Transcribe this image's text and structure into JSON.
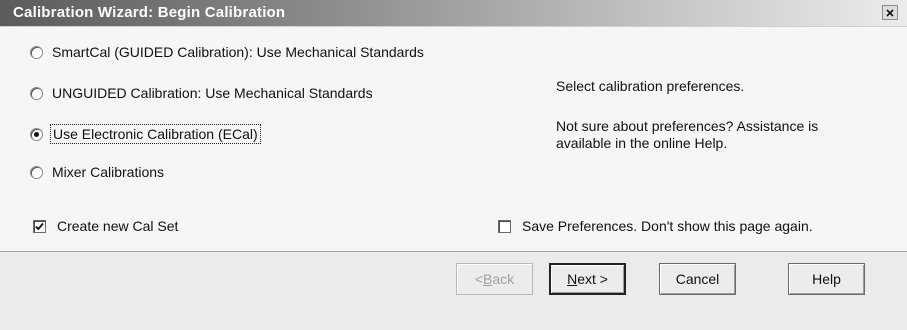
{
  "window": {
    "title": "Calibration Wizard: Begin Calibration"
  },
  "options": [
    {
      "label": "SmartCal (GUIDED Calibration): Use Mechanical Standards",
      "selected": false
    },
    {
      "label": "UNGUIDED Calibration: Use Mechanical Standards",
      "selected": false
    },
    {
      "label": "Use Electronic Calibration (ECal)",
      "selected": true
    },
    {
      "label": "Mixer Calibrations",
      "selected": false
    }
  ],
  "info": {
    "line1": "Select calibration preferences.",
    "line2": "Not sure about preferences?  Assistance is",
    "line3": "available in the online Help."
  },
  "create_cal_set": {
    "label": "Create new Cal Set",
    "checked": true
  },
  "save_preferences": {
    "label": "Save Preferences. Don't show this page again.",
    "checked": false
  },
  "buttons": {
    "back": "< Back",
    "next": "Next >",
    "cancel": "Cancel",
    "help": "Help"
  }
}
